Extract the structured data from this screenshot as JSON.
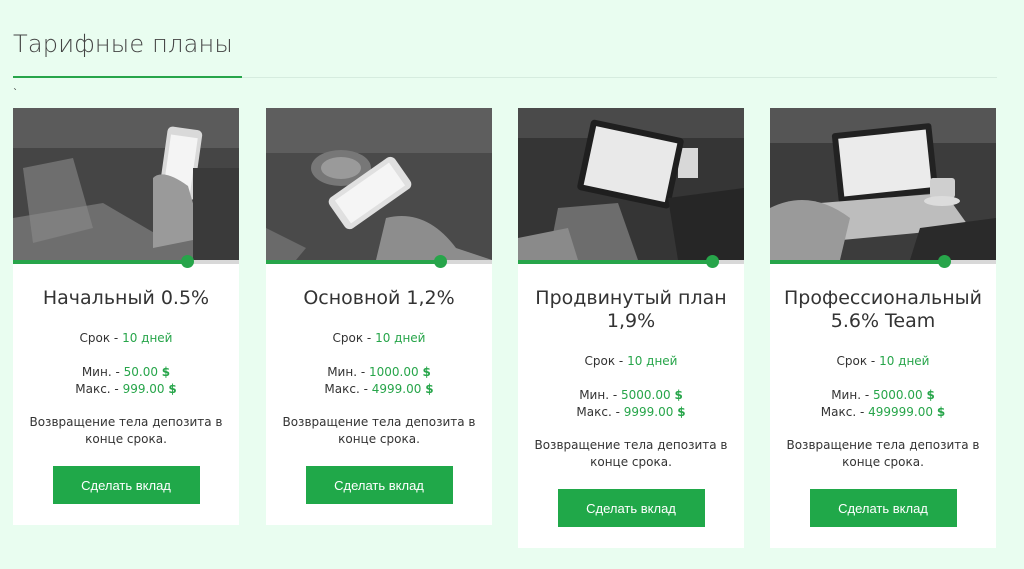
{
  "page": {
    "title": "Тарифные планы",
    "tick": "`",
    "accent_color": "#27a54a",
    "background_color": "#e9fdf0"
  },
  "labels": {
    "term": "Срок - ",
    "min": "Мин. - ",
    "max": "Макс. - ",
    "currency": "$"
  },
  "plans": [
    {
      "name": "Начальный 0.5%",
      "term": "10 дней",
      "min": "50.00",
      "max": "999.00",
      "description": "Возвращение тела депозита в конце срока.",
      "button": "Сделать вклад",
      "progress": 0.77,
      "image": "phone-icon"
    },
    {
      "name": "Основной 1,2%",
      "term": "10 дней",
      "min": "1000.00",
      "max": "4999.00",
      "description": "Возвращение тела депозита в конце срока.",
      "button": "Сделать вклад",
      "progress": 0.77,
      "image": "phone-landscape-icon"
    },
    {
      "name": "Продвинутый план 1,9%",
      "term": "10 дней",
      "min": "5000.00",
      "max": "9999.00",
      "description": "Возвращение тела депозита в конце срока.",
      "button": "Сделать вклад",
      "progress": 0.86,
      "image": "tablet-icon"
    },
    {
      "name": "Профессиональный 5.6% Team",
      "term": "10 дней",
      "min": "5000.00",
      "max": "499999.00",
      "description": "Возвращение тела депозита в конце срока.",
      "button": "Сделать вклад",
      "progress": 0.77,
      "image": "laptop-icon"
    }
  ]
}
